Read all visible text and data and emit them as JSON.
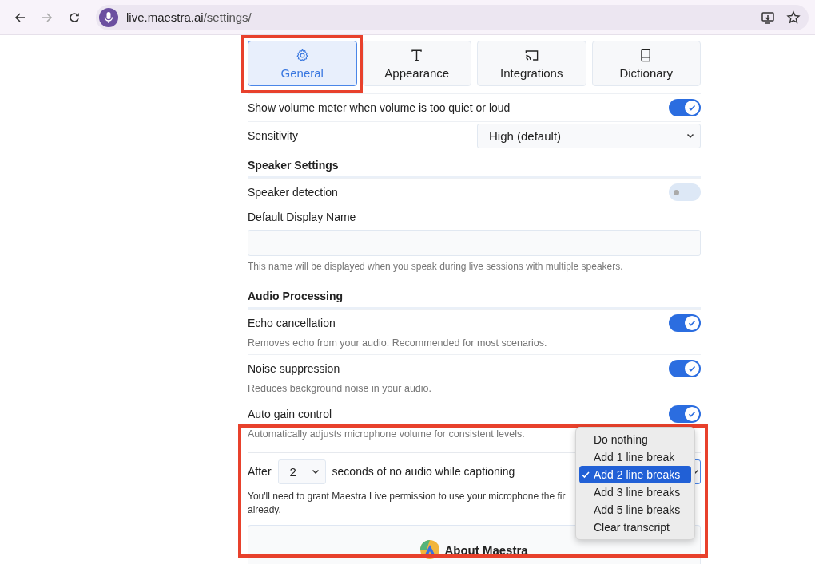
{
  "browser": {
    "url_host": "live.maestra.ai",
    "url_path": "/settings/"
  },
  "tabs": [
    {
      "label": "General",
      "selected": true,
      "highlighted": true
    },
    {
      "label": "Appearance",
      "selected": false,
      "highlighted": false
    },
    {
      "label": "Integrations",
      "selected": false,
      "highlighted": false
    },
    {
      "label": "Dictionary",
      "selected": false,
      "highlighted": false
    }
  ],
  "settings": [
    {
      "kind": "toggle",
      "label": "Show volume meter when volume is too quiet or loud",
      "on": true
    },
    {
      "kind": "select",
      "label": "Sensitivity",
      "value": "High (default)"
    },
    {
      "kind": "heading",
      "label": "Speaker Settings"
    },
    {
      "kind": "toggle",
      "label": "Speaker detection",
      "on": false
    },
    {
      "kind": "text",
      "label": "Default Display Name",
      "hint": "This name will be displayed when you speak during live sessions with multiple speakers."
    },
    {
      "kind": "heading",
      "label": "Audio Processing"
    },
    {
      "kind": "toggle",
      "label": "Echo cancellation",
      "on": true,
      "description": "Removes echo from your audio. Recommended for most scenarios."
    },
    {
      "kind": "toggle",
      "label": "Noise suppression",
      "on": true,
      "description": "Reduces background noise in your audio."
    },
    {
      "kind": "toggle",
      "label": "Auto gain control",
      "on": true,
      "description": "Automatically adjusts microphone volume for consistent levels."
    }
  ],
  "silence_rule": {
    "highlighted": true,
    "before": "After",
    "seconds": "2",
    "after": "seconds of no audio while captioning",
    "note_lines": [
      "You'll need to grant Maestra Live permission to use your microphone the fir",
      "already."
    ],
    "menu": [
      {
        "label": "Do nothing",
        "selected": false
      },
      {
        "label": "Add 1 line break",
        "selected": false
      },
      {
        "label": "Add 2 line breaks",
        "selected": true
      },
      {
        "label": "Add 3 line breaks",
        "selected": false
      },
      {
        "label": "Add 5 line breaks",
        "selected": false
      },
      {
        "label": "Clear transcript",
        "selected": false
      }
    ]
  },
  "about": {
    "title": "About Maestra"
  }
}
